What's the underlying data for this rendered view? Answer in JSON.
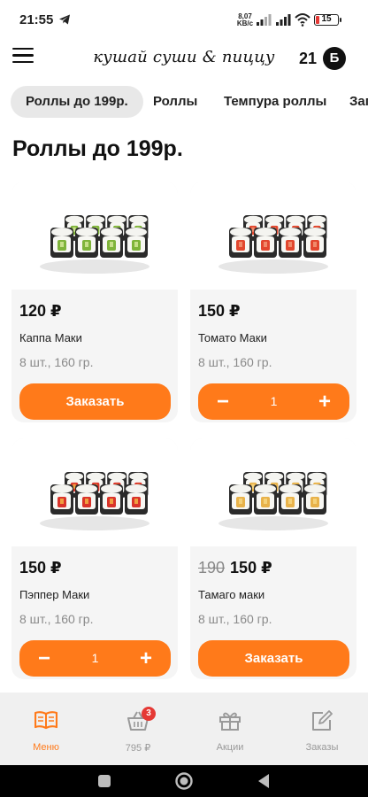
{
  "status_bar": {
    "time": "21:55",
    "net_speed_value": "8,07",
    "net_speed_unit": "KB/c",
    "battery": "15",
    "battery_level": 0.15,
    "battery_color": "#e53935"
  },
  "header": {
    "logo_text": "кушай суши & пиццу",
    "bonus_count": "21",
    "bonus_badge": "Б"
  },
  "tabs": [
    {
      "label": "Роллы до 199р.",
      "active": true
    },
    {
      "label": "Роллы",
      "active": false
    },
    {
      "label": "Темпура роллы",
      "active": false
    },
    {
      "label": "Зап",
      "active": false
    }
  ],
  "section_title": "Роллы до 199р.",
  "products": [
    {
      "name": "Каппа Маки",
      "price": "120 ₽",
      "old_price": "",
      "meta": "8 шт., 160 гр.",
      "action": "Заказать",
      "in_cart": false,
      "filling": "cucumber"
    },
    {
      "name": "Томато Маки",
      "price": "150 ₽",
      "old_price": "",
      "meta": "8 шт., 160 гр.",
      "in_cart": true,
      "quantity": "1",
      "filling": "tomato"
    },
    {
      "name": "Пэппер Маки",
      "price": "150 ₽",
      "old_price": "",
      "meta": "8 шт., 160 гр.",
      "in_cart": true,
      "quantity": "1",
      "filling": "pepper"
    },
    {
      "name": "Тамаго маки",
      "price": "150 ₽",
      "old_price": "190",
      "meta": "8 шт., 160 гр.",
      "action": "Заказать",
      "in_cart": false,
      "filling": "tamago"
    }
  ],
  "bottom_nav": [
    {
      "label": "Меню",
      "icon": "book-icon",
      "active": true
    },
    {
      "label": "795 ₽",
      "icon": "basket-icon",
      "active": false,
      "badge": "3"
    },
    {
      "label": "Акции",
      "icon": "gift-icon",
      "active": false
    },
    {
      "label": "Заказы",
      "icon": "edit-icon",
      "active": false
    }
  ],
  "colors": {
    "accent": "#ff7a1a",
    "badge": "#e53935",
    "tab_active_bg": "#e8e8e8",
    "card_bg": "#f5f5f5"
  }
}
